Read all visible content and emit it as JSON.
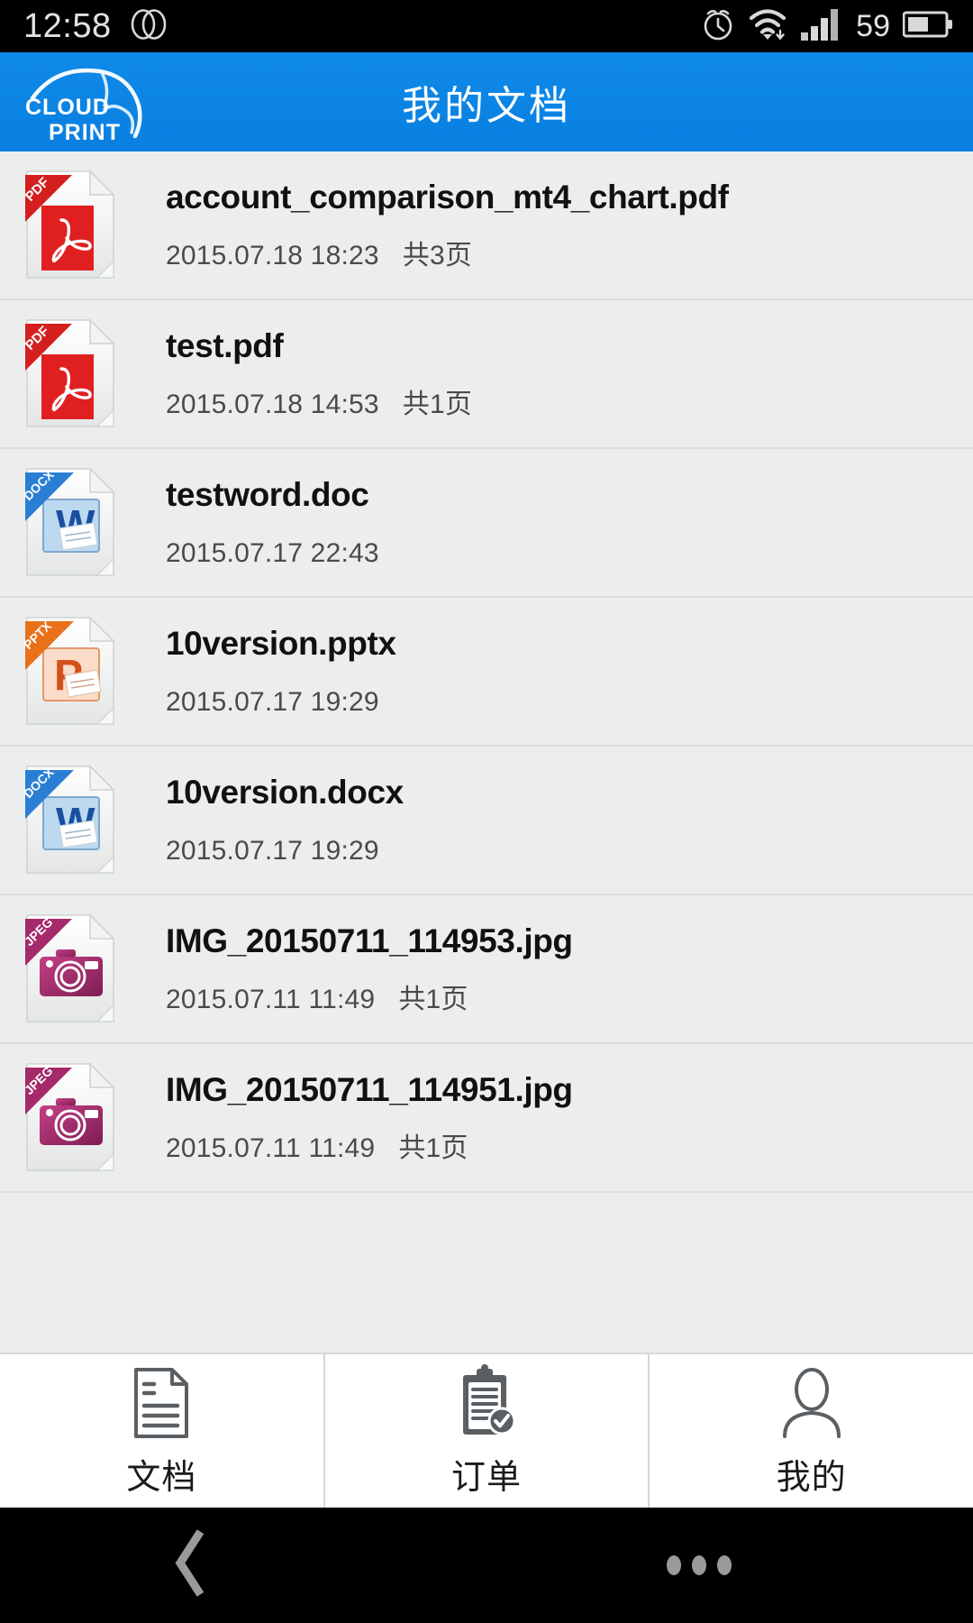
{
  "status_bar": {
    "time": "12:58",
    "battery_percent": "59",
    "icons": [
      "dual-sim-icon",
      "alarm-icon",
      "wifi-icon",
      "signal-icon",
      "battery-icon"
    ]
  },
  "header": {
    "title": "我的文档",
    "logo_line1": "CLOUD",
    "logo_line2": "PRINT",
    "accent_color": "#0b84e4"
  },
  "files": [
    {
      "name": "account_comparison_mt4_chart.pdf",
      "date": "2015.07.18 18:23",
      "pages": "共3页",
      "type": "pdf",
      "ribbon": "PDF",
      "ribbon_color": "#e02020"
    },
    {
      "name": "test.pdf",
      "date": "2015.07.18 14:53",
      "pages": "共1页",
      "type": "pdf",
      "ribbon": "PDF",
      "ribbon_color": "#e02020"
    },
    {
      "name": "testword.doc",
      "date": "2015.07.17 22:43",
      "pages": "",
      "type": "word",
      "ribbon": "DOCX",
      "ribbon_color": "#2a7fd4"
    },
    {
      "name": "10version.pptx",
      "date": "2015.07.17 19:29",
      "pages": "",
      "type": "powerpoint",
      "ribbon": "PPTX",
      "ribbon_color": "#e8711a"
    },
    {
      "name": "10version.docx",
      "date": "2015.07.17 19:29",
      "pages": "",
      "type": "word",
      "ribbon": "DOCX",
      "ribbon_color": "#2a7fd4"
    },
    {
      "name": "IMG_20150711_114953.jpg",
      "date": "2015.07.11 11:49",
      "pages": "共1页",
      "type": "jpeg",
      "ribbon": "JPEG",
      "ribbon_color": "#a52a6b"
    },
    {
      "name": "IMG_20150711_114951.jpg",
      "date": "2015.07.11 11:49",
      "pages": "共1页",
      "type": "jpeg",
      "ribbon": "JPEG",
      "ribbon_color": "#a52a6b"
    }
  ],
  "tabbar": {
    "tabs": [
      {
        "label": "文档",
        "icon": "document-icon",
        "active": true
      },
      {
        "label": "订单",
        "icon": "clipboard-check-icon",
        "active": false
      },
      {
        "label": "我的",
        "icon": "person-icon",
        "active": false
      }
    ]
  },
  "android_nav": {
    "back": "back-icon",
    "menu": "overflow-menu-icon"
  }
}
